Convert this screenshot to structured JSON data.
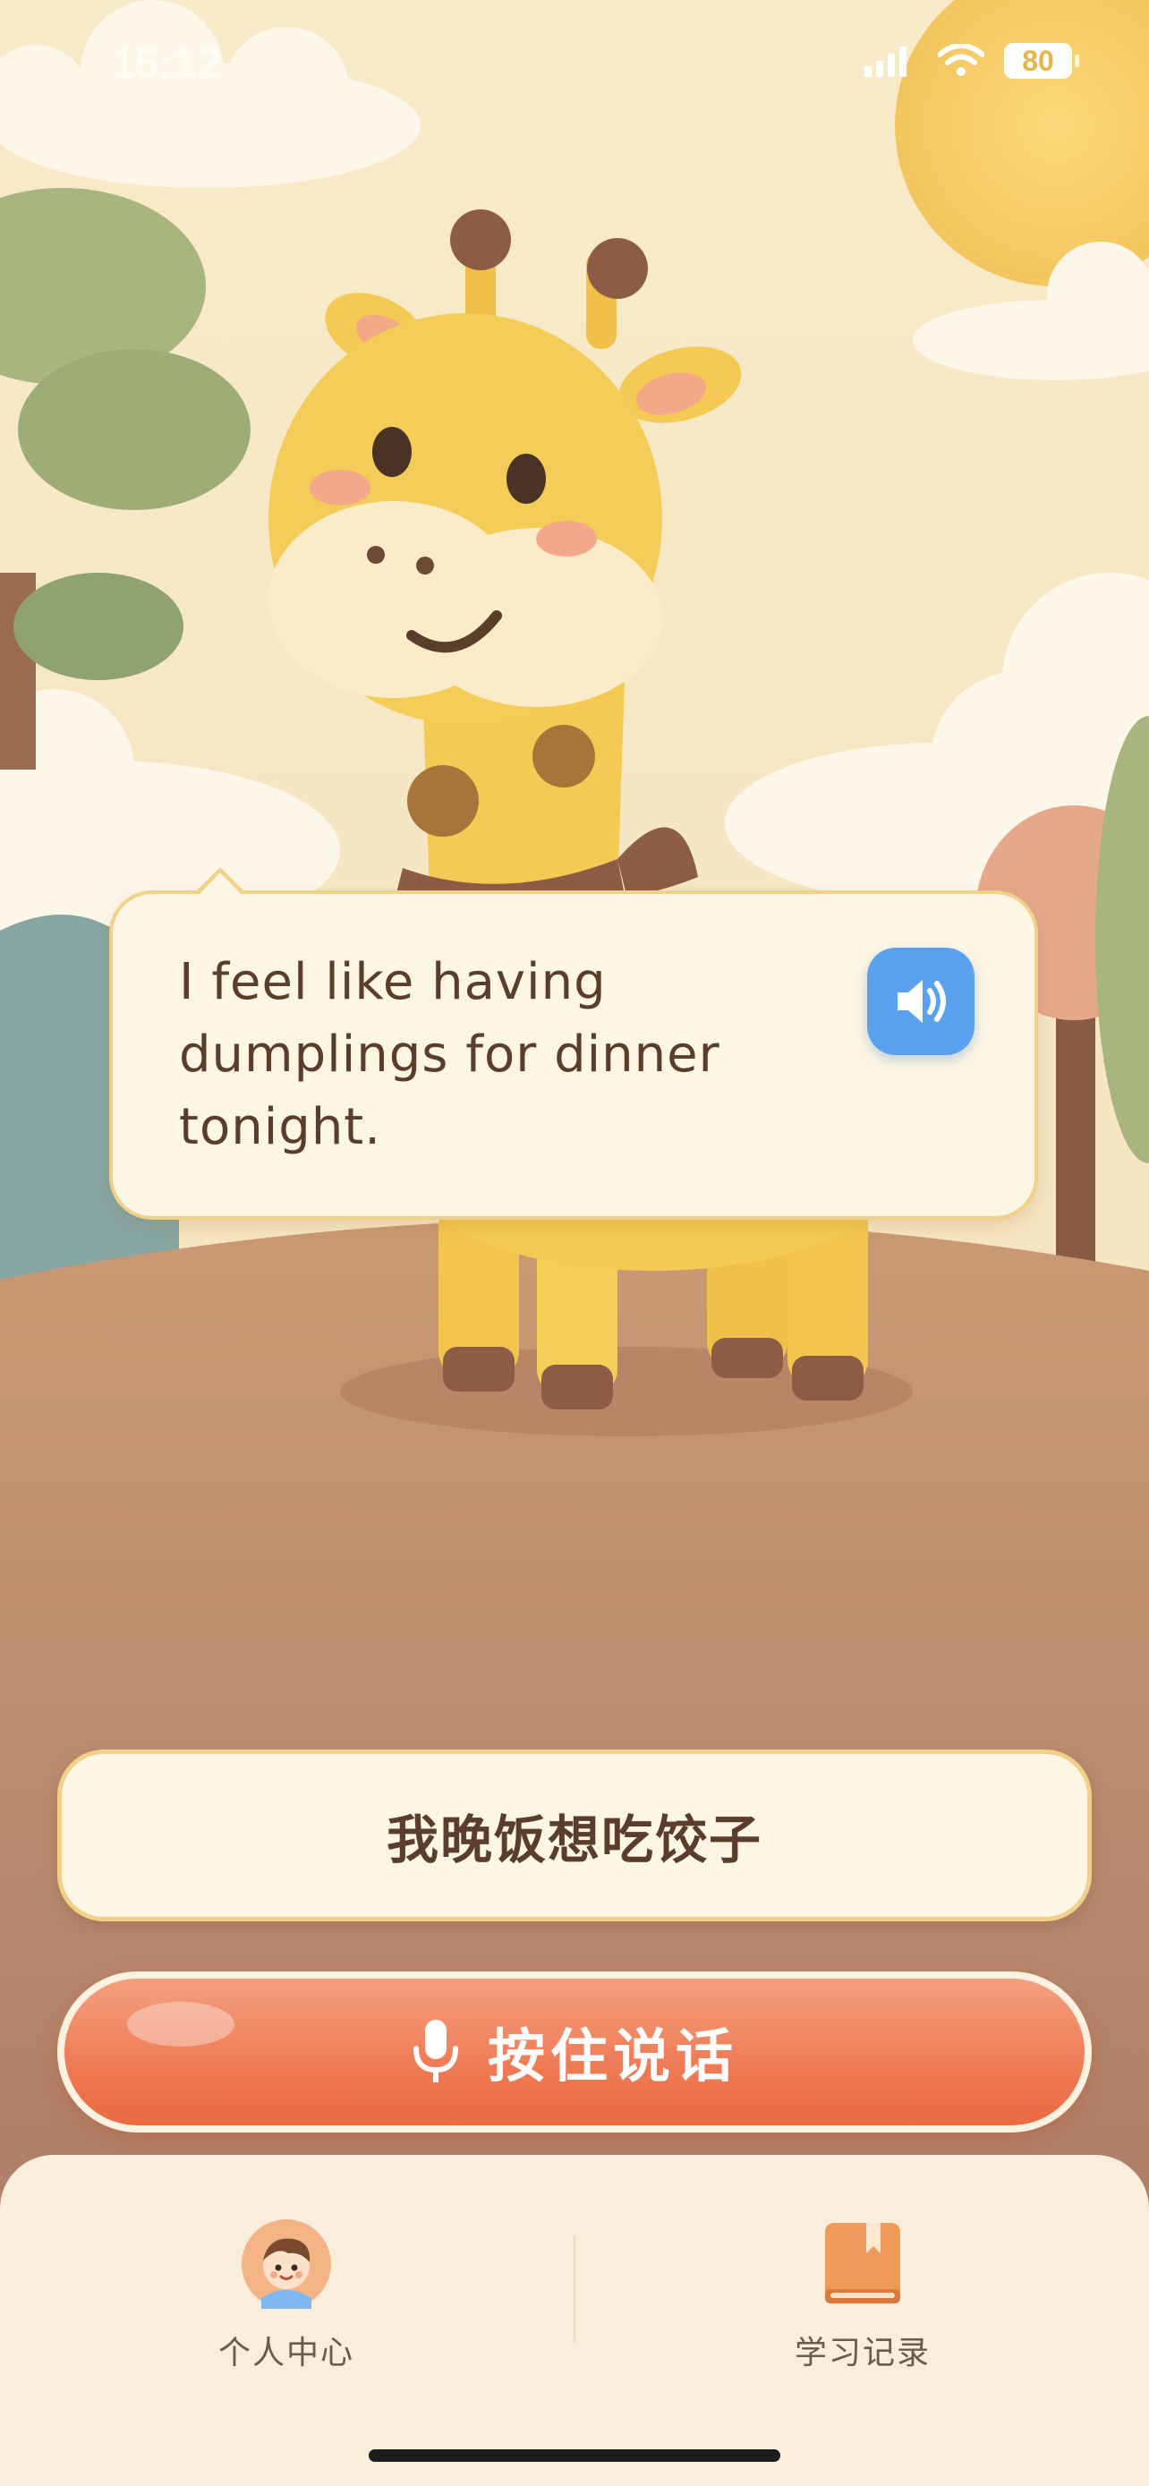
{
  "status_bar": {
    "time": "15:12",
    "battery": "80"
  },
  "dialogue": {
    "english_text": "I feel like having dumplings for dinner tonight.",
    "translation": "我晚饭想吃饺子"
  },
  "actions": {
    "talk_label": "按住说话"
  },
  "tab_bar": {
    "tabs": [
      {
        "label": "个人中心",
        "icon": "child-avatar-icon"
      },
      {
        "label": "学习记录",
        "icon": "book-icon"
      }
    ]
  },
  "colors": {
    "accent_orange": "#ee7b55",
    "speaker_blue": "#5aa2f0",
    "cream": "#fdf6e4",
    "text_brown": "#5a3d2b"
  }
}
